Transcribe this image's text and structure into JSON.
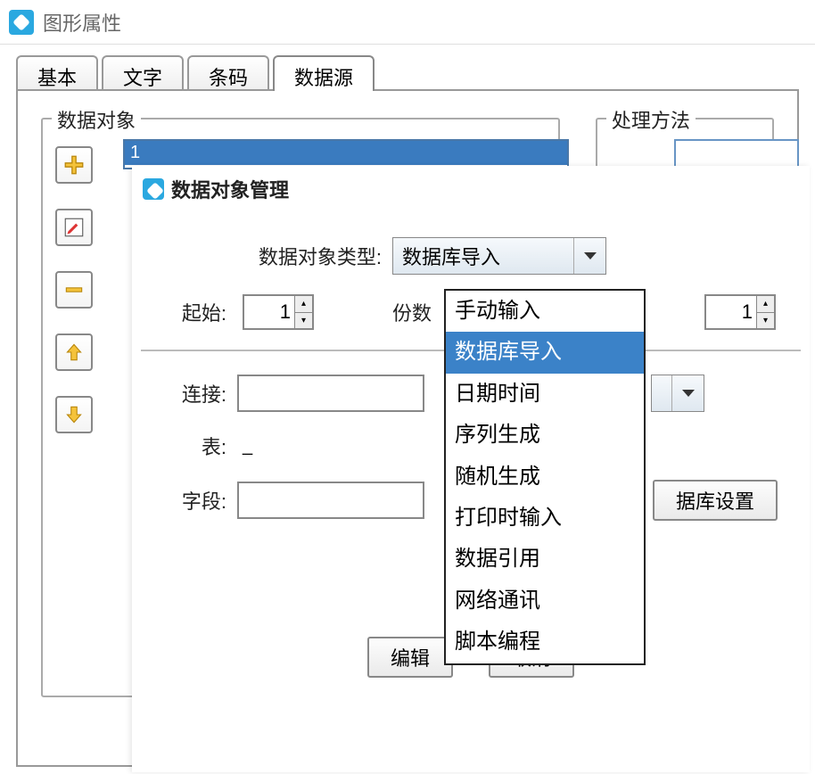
{
  "window": {
    "title": "图形属性"
  },
  "tabs": {
    "items": [
      "基本",
      "文字",
      "条码",
      "数据源"
    ],
    "active_index": 3
  },
  "groups": {
    "data_object_legend": "数据对象",
    "method_legend": "处理方法"
  },
  "data_list": {
    "item0": "1"
  },
  "dialog": {
    "title": "数据对象管理",
    "type_label": "数据对象类型:",
    "type_value": "数据库导入",
    "start_label": "起始:",
    "start_value": "1",
    "copies_label": "份数",
    "copies_value": "1",
    "conn_label": "连接:",
    "table_label": "表:",
    "table_value": "_",
    "field_label": "字段:",
    "db_button": "据库设置",
    "edit_button": "编辑",
    "cancel_button": "取消"
  },
  "dropdown_options": [
    "手动输入",
    "数据库导入",
    "日期时间",
    "序列生成",
    "随机生成",
    "打印时输入",
    "数据引用",
    "网络通讯",
    "脚本编程"
  ],
  "dropdown_selected_index": 1
}
